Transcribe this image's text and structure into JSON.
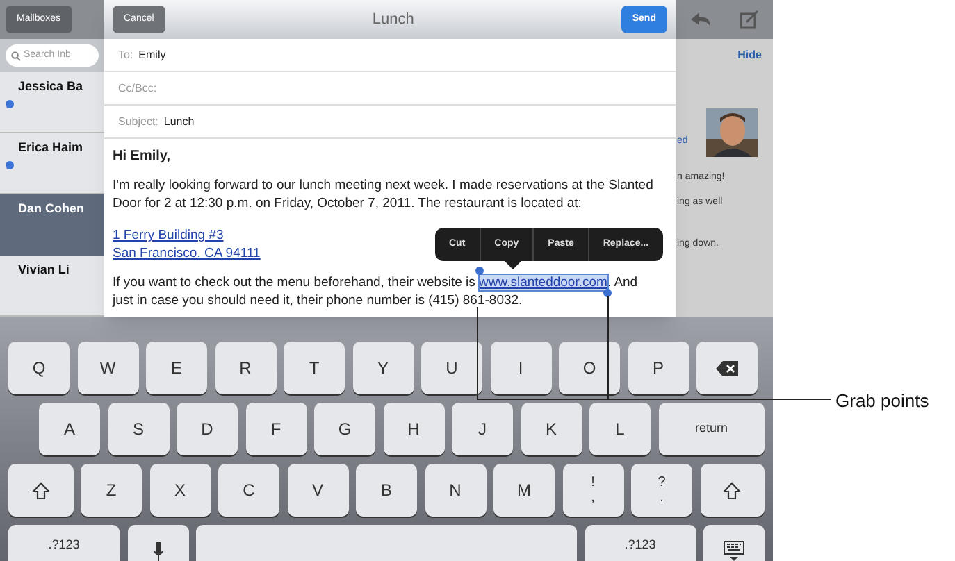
{
  "inbox": {
    "back_button": "Mailboxes",
    "search": {
      "placeholder": "Search Inb"
    },
    "messages": [
      {
        "sender": "Jessica Ba",
        "unread": true,
        "selected": false
      },
      {
        "sender": "Erica Haim",
        "unread": true,
        "selected": false
      },
      {
        "sender": "Dan Cohen",
        "unread": false,
        "selected": true
      },
      {
        "sender": "Vivian Li",
        "unread": false,
        "selected": false
      }
    ]
  },
  "message_pane": {
    "hide_link": "Hide",
    "fragments": [
      "ed",
      "n amazing!",
      "ing as well",
      "ing down."
    ]
  },
  "compose": {
    "cancel": "Cancel",
    "title": "Lunch",
    "send": "Send",
    "fields": [
      {
        "label": "To:",
        "value": "Emily"
      },
      {
        "label": "Cc/Bcc:"
      },
      {
        "label": "Subject:",
        "value": "Lunch"
      }
    ],
    "greeting": "Hi Emily,",
    "paragraph_1": [
      "I'm really looking forward to our lunch meeting next week. I made reservations at the Slanted",
      "Door for 2 at 12:30 p.m. on Friday, October 7, 2011. The restaurant is located at:"
    ],
    "address_links": [
      "1 Ferry Building #3",
      "San Francisco, CA 94111"
    ],
    "paragraph_2": {
      "before": "If you want to check out the menu beforehand, their website is ",
      "link": "www.slanteddoor.com",
      "selected": true,
      "after": ". And",
      "line_2": "just in case you should need it, their phone number is (415) 861-8032."
    },
    "edit_menu": [
      "Cut",
      "Copy",
      "Paste",
      "Replace..."
    ]
  },
  "keyboard": [
    [
      {
        "kind": "key",
        "label": "Q"
      },
      {
        "kind": "key",
        "label": "W"
      },
      {
        "kind": "key",
        "label": "E"
      },
      {
        "kind": "key",
        "label": "R"
      },
      {
        "kind": "key",
        "label": "T"
      },
      {
        "kind": "key",
        "label": "Y"
      },
      {
        "kind": "key",
        "label": "U"
      },
      {
        "kind": "key",
        "label": "I"
      },
      {
        "kind": "key",
        "label": "O"
      },
      {
        "kind": "key",
        "label": "P"
      },
      {
        "kind": "delete"
      }
    ],
    [
      {
        "kind": "key",
        "label": "A"
      },
      {
        "kind": "key",
        "label": "S"
      },
      {
        "kind": "key",
        "label": "D"
      },
      {
        "kind": "key",
        "label": "F"
      },
      {
        "kind": "key",
        "label": "G"
      },
      {
        "kind": "key",
        "label": "H"
      },
      {
        "kind": "key",
        "label": "J"
      },
      {
        "kind": "key",
        "label": "K"
      },
      {
        "kind": "key",
        "label": "L"
      },
      {
        "kind": "return",
        "label": "return"
      }
    ],
    [
      {
        "kind": "shift"
      },
      {
        "kind": "key",
        "label": "Z"
      },
      {
        "kind": "key",
        "label": "X"
      },
      {
        "kind": "key",
        "label": "C"
      },
      {
        "kind": "key",
        "label": "V"
      },
      {
        "kind": "key",
        "label": "B"
      },
      {
        "kind": "key",
        "label": "N"
      },
      {
        "kind": "key",
        "label": "M"
      },
      {
        "kind": "key",
        "label": "!",
        "sub_label": ","
      },
      {
        "kind": "key",
        "label": "?",
        "sub_label": "."
      },
      {
        "kind": "shift"
      }
    ],
    [
      {
        "kind": "numbers",
        "label": ".?123"
      },
      {
        "kind": "mic"
      },
      {
        "kind": "space"
      },
      {
        "kind": "numbers",
        "label": ".?123"
      },
      {
        "kind": "hide"
      }
    ]
  ],
  "callout": "Grab points"
}
